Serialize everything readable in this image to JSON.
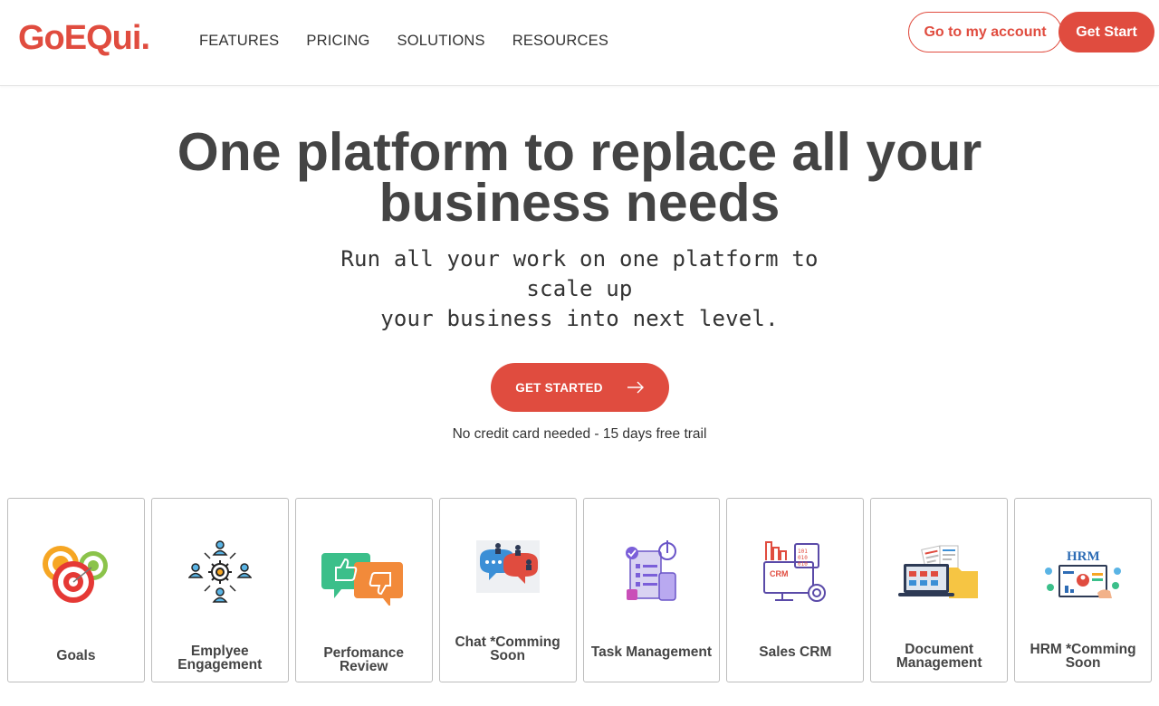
{
  "header": {
    "logo": "GoEQui.",
    "nav": [
      "FEATURES",
      "PRICING",
      "SOLUTIONS",
      "RESOURCES"
    ],
    "account_label": "Go to my account",
    "start_label": "Get Start"
  },
  "hero": {
    "title": "One platform to replace all your business needs",
    "subtitle_line1": "Run all your work on one platform to scale up",
    "subtitle_line2": "your business into next level.",
    "cta_label": "GET STARTED",
    "note": "No credit card needed - 15 days free trail"
  },
  "cards": [
    {
      "label": "Goals",
      "icon": "target-icon"
    },
    {
      "label": "Emplyee Engagement",
      "icon": "team-gear-icon"
    },
    {
      "label": "Perfomance Review",
      "icon": "thumbs-feedback-icon"
    },
    {
      "label": "Chat *Comming Soon",
      "icon": "chat-people-icon"
    },
    {
      "label": "Task Management",
      "icon": "task-checklist-icon"
    },
    {
      "label": "Sales CRM",
      "icon": "crm-monitor-icon"
    },
    {
      "label": "Document Management",
      "icon": "document-folder-icon"
    },
    {
      "label": "HRM *Comming Soon",
      "icon": "hrm-board-icon"
    }
  ],
  "colors": {
    "accent": "#e04c3f",
    "text": "#444444",
    "border": "#bdbdbd"
  }
}
